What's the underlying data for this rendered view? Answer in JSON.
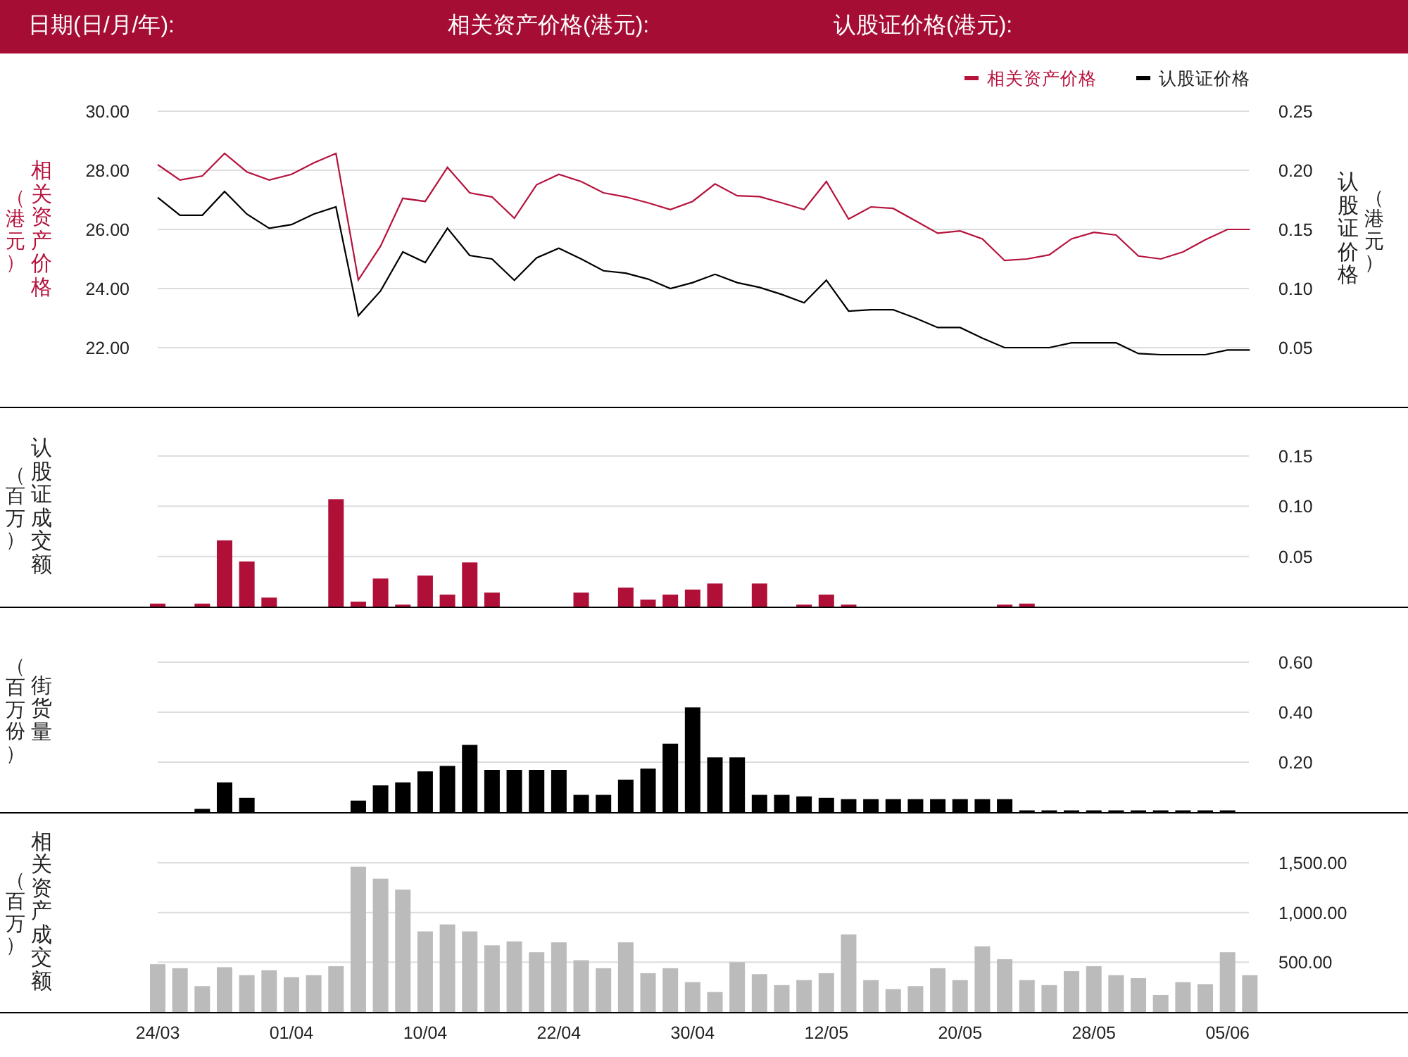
{
  "header": {
    "labels": [
      "日期(日/月/年):",
      "相关资产价格(港元):",
      "认股证价格(港元):"
    ]
  },
  "panels": [
    {
      "unit_label": "（港元）",
      "right_unit_label": "（港元）",
      "chart_data": {
        "type": "line",
        "legend": "top-right",
        "ylabel": "相关资产价格",
        "y2label": "认股证价格",
        "grid": true,
        "ylim": [
          20,
          30
        ],
        "yticks": [
          {
            "value": 22,
            "label": "22.00"
          },
          {
            "value": 24,
            "label": "24.00"
          },
          {
            "value": 26,
            "label": "26.00"
          },
          {
            "value": 28,
            "label": "28.00"
          },
          {
            "value": 30,
            "label": "30.00"
          }
        ],
        "y2lim": [
          0,
          0.25
        ],
        "y2ticks": [
          {
            "value": 0.05,
            "label": "0.05"
          },
          {
            "value": 0.1,
            "label": "0.10"
          },
          {
            "value": 0.15,
            "label": "0.15"
          },
          {
            "value": 0.2,
            "label": "0.20"
          },
          {
            "value": 0.25,
            "label": "0.25"
          }
        ],
        "series": [
          {
            "name": "相关资产价格",
            "color": "#b5123c",
            "values": [
              28.19,
              27.67,
              27.81,
              28.57,
              27.95,
              27.67,
              27.86,
              28.25,
              28.57,
              24.29,
              25.44,
              27.05,
              26.95,
              28.1,
              27.24,
              27.1,
              26.38,
              27.51,
              27.86,
              27.62,
              27.24,
              27.1,
              26.9,
              26.67,
              26.95,
              27.54,
              27.14,
              27.11,
              26.9,
              26.67,
              27.62,
              26.35,
              26.76,
              26.71,
              26.29,
              25.87,
              25.95,
              25.68,
              24.95,
              25.0,
              25.14,
              25.68,
              25.9,
              25.81,
              25.1,
              25.0,
              25.24,
              25.65,
              26.0,
              26.0
            ]
          },
          {
            "name": "认股证价格",
            "color": "#000000",
            "axis": "y2",
            "values": [
              0.177,
              0.162,
              0.162,
              0.182,
              0.163,
              0.151,
              0.154,
              0.163,
              0.169,
              0.077,
              0.098,
              0.131,
              0.122,
              0.151,
              0.128,
              0.125,
              0.107,
              0.126,
              0.134,
              0.125,
              0.115,
              0.113,
              0.108,
              0.1,
              0.105,
              0.112,
              0.105,
              0.101,
              0.095,
              0.088,
              0.107,
              0.081,
              0.082,
              0.082,
              0.075,
              0.067,
              0.067,
              0.058,
              0.05,
              0.05,
              0.05,
              0.054,
              0.054,
              0.054,
              0.045,
              0.044,
              0.044,
              0.044,
              0.048,
              0.048
            ]
          }
        ]
      }
    },
    {
      "unit_label": "（百万）",
      "chart_data": {
        "type": "bar",
        "grid": true,
        "ylim": [
          0,
          0.15
        ],
        "yticks": [
          {
            "value": 0.05,
            "label": "0.05"
          },
          {
            "value": 0.1,
            "label": "0.10"
          },
          {
            "value": 0.15,
            "label": "0.15"
          }
        ],
        "series": [
          {
            "name": "认股证成交额",
            "color": "#b01037",
            "values": [
              0.003,
              0,
              0.003,
              0.066,
              0.045,
              0.009,
              0,
              0,
              0.107,
              0.005,
              0.028,
              0.002,
              0.031,
              0.012,
              0.044,
              0.014,
              0,
              0,
              0,
              0.014,
              0,
              0.019,
              0.007,
              0.012,
              0.017,
              0.023,
              0,
              0.023,
              0,
              0.002,
              0.012,
              0.002,
              0,
              0,
              0,
              0,
              0,
              0,
              0.002,
              0.003,
              0,
              0,
              0,
              0,
              0,
              0,
              0,
              0,
              0,
              0
            ]
          }
        ]
      }
    },
    {
      "unit_label": "（百万份）",
      "chart_data": {
        "type": "bar",
        "grid": true,
        "ylim": [
          0,
          0.6
        ],
        "yticks": [
          {
            "value": 0.2,
            "label": "0.20"
          },
          {
            "value": 0.4,
            "label": "0.40"
          },
          {
            "value": 0.6,
            "label": "0.60"
          }
        ],
        "series": [
          {
            "name": "街货量",
            "color": "#000000",
            "values": [
              0,
              0,
              0.013,
              0.119,
              0.057,
              0,
              0,
              0,
              0,
              0.046,
              0.107,
              0.119,
              0.163,
              0.185,
              0.269,
              0.169,
              0.169,
              0.169,
              0.169,
              0.069,
              0.069,
              0.13,
              0.174,
              0.274,
              0.419,
              0.219,
              0.219,
              0.069,
              0.069,
              0.063,
              0.057,
              0.052,
              0.052,
              0.052,
              0.052,
              0.052,
              0.052,
              0.052,
              0.052,
              0.007,
              0.007,
              0.007,
              0.007,
              0.007,
              0.007,
              0.007,
              0.007,
              0.007,
              0.007,
              0
            ]
          }
        ]
      }
    },
    {
      "unit_label": "（百万）",
      "chart_data": {
        "type": "bar",
        "grid": true,
        "ylim": [
          0,
          1500
        ],
        "yticks": [
          {
            "value": 500,
            "label": "500.00"
          },
          {
            "value": 1000,
            "label": "1,000.00"
          },
          {
            "value": 1500,
            "label": "1,500.00"
          }
        ],
        "categories": [
          "24/03",
          null,
          null,
          null,
          null,
          null,
          "01/04",
          null,
          null,
          null,
          null,
          null,
          "10/04",
          null,
          null,
          null,
          null,
          null,
          "22/04",
          null,
          null,
          null,
          null,
          null,
          "30/04",
          null,
          null,
          null,
          null,
          null,
          "12/05",
          null,
          null,
          null,
          null,
          null,
          "20/05",
          null,
          null,
          null,
          null,
          null,
          "28/05",
          null,
          null,
          null,
          null,
          null,
          "05/06",
          null
        ],
        "series": [
          {
            "name": "相关资产成交额",
            "color": "#bbbbbb",
            "values": [
              480,
              440,
              260,
              450,
              370,
              420,
              350,
              370,
              460,
              1460,
              1340,
              1230,
              810,
              880,
              810,
              670,
              710,
              600,
              700,
              520,
              440,
              700,
              390,
              440,
              300,
              200,
              500,
              380,
              270,
              320,
              390,
              780,
              320,
              230,
              260,
              440,
              320,
              660,
              530,
              320,
              270,
              410,
              460,
              370,
              340,
              170,
              300,
              280,
              600,
              370
            ]
          }
        ]
      }
    }
  ]
}
